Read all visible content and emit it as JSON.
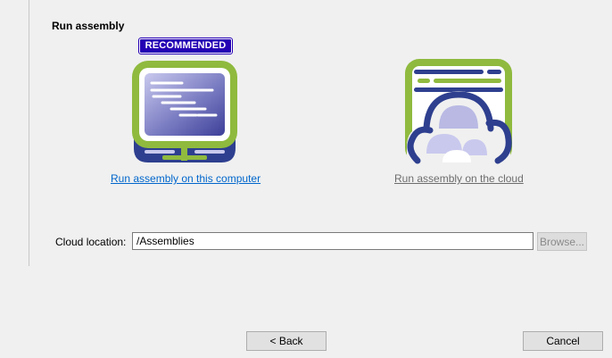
{
  "section": {
    "title": "Run assembly"
  },
  "options": {
    "local": {
      "badge": "RECOMMENDED",
      "link_label": "Run assembly on this computer",
      "icon": "computer-monitor-icon"
    },
    "cloud": {
      "link_label": "Run assembly on the cloud",
      "icon": "cloud-server-icon"
    }
  },
  "cloud_location": {
    "label": "Cloud location:",
    "value": "/Assemblies",
    "browse_label": "Browse..."
  },
  "footer": {
    "back_label": "< Back",
    "cancel_label": "Cancel"
  },
  "colors": {
    "icon_green": "#8fba3e",
    "icon_navy": "#2e3f8f",
    "screen_purple": "#6466b0",
    "badge_blue": "#2400b4",
    "link_blue": "#0066cc",
    "link_gray": "#6d6d6d"
  }
}
